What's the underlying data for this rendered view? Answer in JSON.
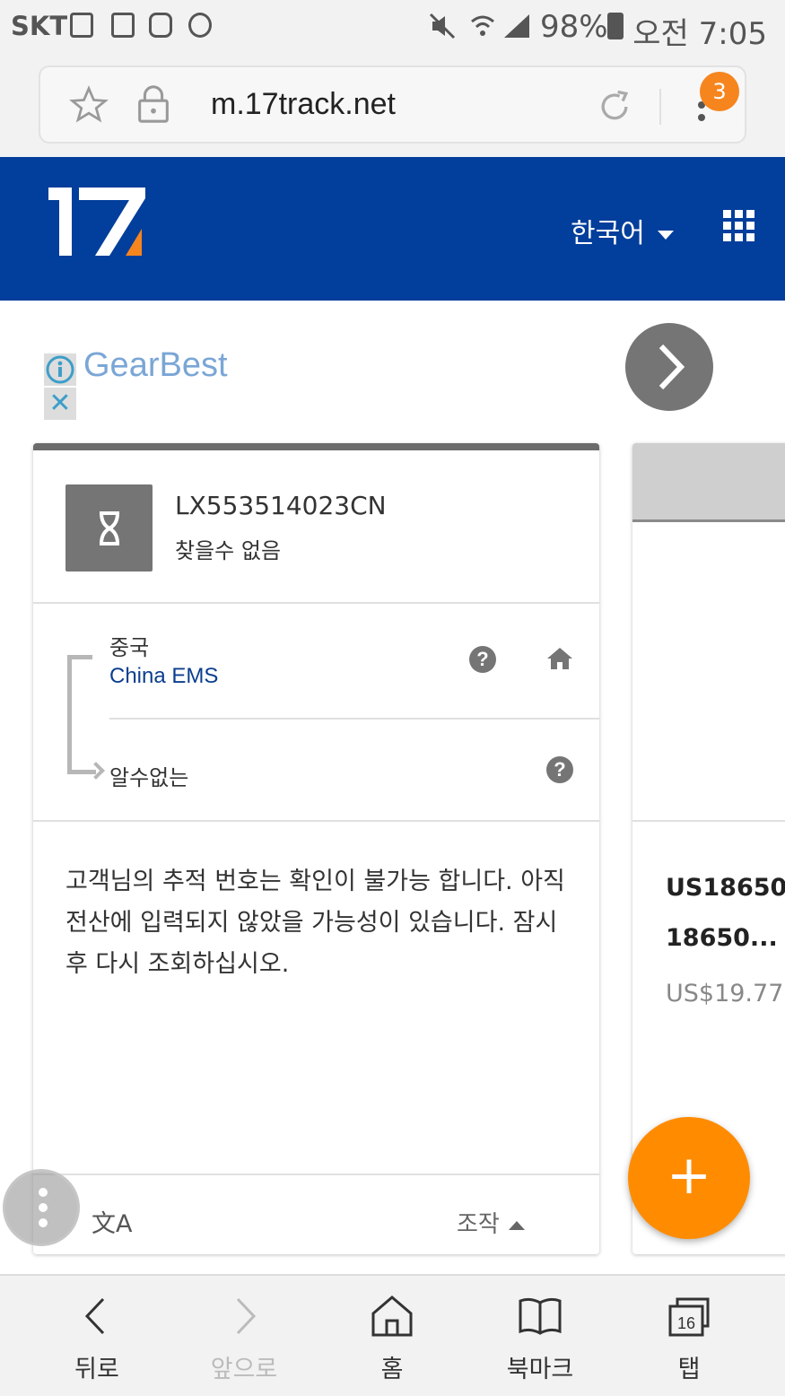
{
  "status_bar": {
    "carrier": "SKT",
    "battery": "98%",
    "time": "오전 7:05"
  },
  "browser": {
    "url": "m.17track.net",
    "tab_badge_count": "3"
  },
  "header": {
    "logo_text": "17",
    "language": "한국어"
  },
  "ad": {
    "brand": "GearBest",
    "info_icon": "i",
    "close_icon": "✕"
  },
  "tracking_card": {
    "tracking_number": "LX553514023CN",
    "status": "찾을수 없음",
    "origin_country": "중국",
    "carrier": "China EMS",
    "destination_country": "알수없는",
    "message": "고객님의 추적 번호는 확인이 불가능 합니다. 아직 전산에 입력되지 않았을 가능성이 있습니다. 잠시후 다시 조회하십시오.",
    "translate_icon": "文A",
    "actions_label": "조작"
  },
  "product_card": {
    "name": "US18650\n18650...",
    "price": "US$19.77"
  },
  "fab_label": "+",
  "bottom_nav": {
    "back": "뒤로",
    "forward": "앞으로",
    "home": "홈",
    "bookmarks": "북마크",
    "tabs": "탭",
    "tabs_count": "16"
  },
  "colors": {
    "header_blue": "#023e9b",
    "accent_orange": "#ff8c00",
    "link_blue": "#0b3e8f"
  }
}
